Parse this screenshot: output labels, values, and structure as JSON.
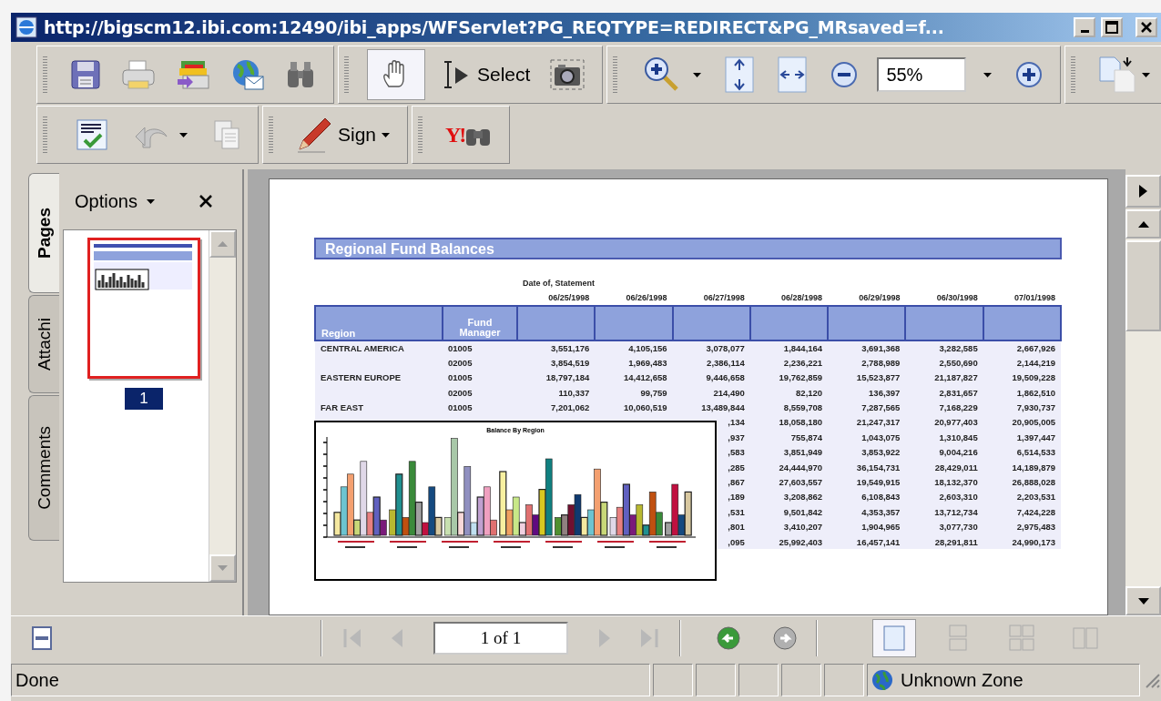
{
  "window": {
    "title": "http://bigscm12.ibi.com:12490/ibi_apps/WFServlet?PG_REQTYPE=REDIRECT&PG_MRsaved=f..."
  },
  "toolbar": {
    "hand_tool": {
      "selected": true
    },
    "select_label": "Select",
    "zoom_value": "55%"
  },
  "toolbar_2": {
    "sign_label": "Sign",
    "search_logo": "Y!"
  },
  "side_tabs": [
    {
      "label": "Pages",
      "selected": true
    },
    {
      "label": "Attachi",
      "selected": false
    },
    {
      "label": "Comments",
      "selected": false
    }
  ],
  "pages_panel": {
    "options_label": "Options",
    "thumbnails": [
      {
        "label": "1",
        "selected": true
      }
    ]
  },
  "report": {
    "title": "Regional Fund Balances",
    "super_header": "Date of, Statement",
    "dates": [
      "06/25/1998",
      "06/26/1998",
      "06/27/1998",
      "06/28/1998",
      "06/29/1998",
      "06/30/1998",
      "07/01/1998"
    ],
    "columns": [
      "Region",
      "Fund Manager"
    ],
    "rows": [
      {
        "region": "CENTRAL AMERICA",
        "manager": "01005",
        "values": [
          "3,551,176",
          "4,105,156",
          "3,078,077",
          "1,844,164",
          "3,691,368",
          "3,282,585",
          "2,667,926"
        ]
      },
      {
        "manager": "02005",
        "values": [
          "3,854,519",
          "1,969,483",
          "2,386,114",
          "2,236,221",
          "2,788,989",
          "2,550,690",
          "2,144,219"
        ]
      },
      {
        "region": "EASTERN EUROPE",
        "manager": "01005",
        "values": [
          "18,797,184",
          "14,412,658",
          "9,446,658",
          "19,762,859",
          "15,523,877",
          "21,187,827",
          "19,509,228"
        ]
      },
      {
        "manager": "02005",
        "values": [
          "110,337",
          "99,759",
          "214,490",
          "82,120",
          "136,397",
          "2,831,657",
          "1,862,510"
        ]
      },
      {
        "region": "FAR EAST",
        "manager": "01005",
        "values": [
          "7,201,062",
          "10,060,519",
          "13,489,844",
          "8,559,708",
          "7,287,565",
          "7,168,229",
          "7,930,737"
        ]
      },
      {
        "values": [
          ",134",
          "18,058,180",
          "21,247,317",
          "20,977,403",
          "20,905,005"
        ]
      },
      {
        "values": [
          ",937",
          "755,874",
          "1,043,075",
          "1,310,845",
          "1,397,447"
        ]
      },
      {
        "values": [
          ",583",
          "3,851,949",
          "3,853,922",
          "9,004,216",
          "6,514,533"
        ]
      },
      {
        "values": [
          ",285",
          "24,444,970",
          "36,154,731",
          "28,429,011",
          "14,189,879"
        ]
      },
      {
        "values": [
          ",867",
          "27,603,557",
          "19,549,915",
          "18,132,370",
          "26,888,028"
        ]
      },
      {
        "values": [
          ",189",
          "3,208,862",
          "6,108,843",
          "2,603,310",
          "2,203,531"
        ]
      },
      {
        "values": [
          ",531",
          "9,501,842",
          "4,353,357",
          "13,712,734",
          "7,424,228"
        ]
      },
      {
        "values": [
          ",801",
          "3,410,207",
          "1,904,965",
          "3,077,730",
          "2,975,483"
        ]
      },
      {
        "values": [
          ",095",
          "25,992,403",
          "16,457,141",
          "28,291,811",
          "24,990,173"
        ]
      }
    ]
  },
  "chart": {
    "title": "Balance By Region"
  },
  "navigation": {
    "buttons": [
      {
        "kind": "first",
        "disabled": true
      },
      {
        "kind": "previous",
        "disabled": true
      }
    ],
    "page_field": "1 of 1",
    "buttons_after": [
      {
        "kind": "next",
        "disabled": true
      },
      {
        "kind": "last",
        "disabled": true
      }
    ],
    "history": [
      {
        "kind": "back",
        "disabled": false
      },
      {
        "kind": "forward",
        "disabled": true
      }
    ],
    "view_modes": [
      {
        "kind": "single",
        "selected": true
      },
      {
        "kind": "continuous",
        "selected": false
      },
      {
        "kind": "facing-continuous",
        "selected": false
      },
      {
        "kind": "facing",
        "selected": false
      }
    ]
  },
  "status_bar": {
    "text": "Done",
    "zone": "Unknown Zone"
  }
}
